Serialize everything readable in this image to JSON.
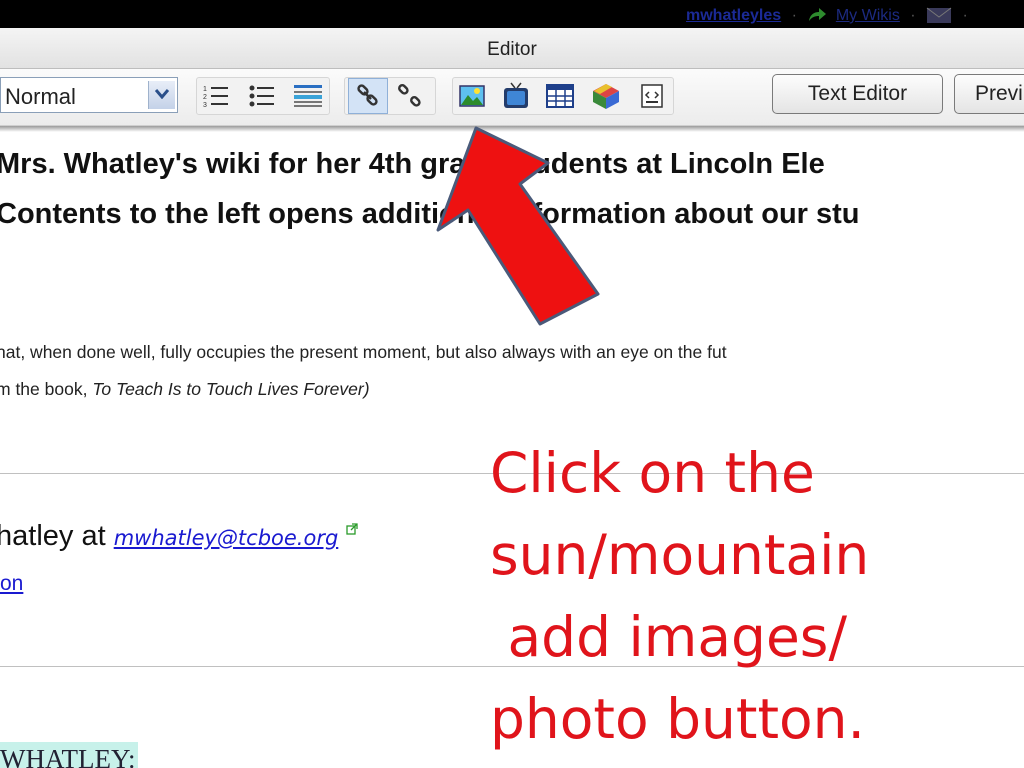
{
  "topbar": {
    "user": "mwhatleyles",
    "my_wikis": "My Wikis",
    "sep": "·"
  },
  "editor": {
    "title": "Editor"
  },
  "toolbar": {
    "format_value": "Normal",
    "text_editor": "Text Editor",
    "preview": "Previ"
  },
  "content": {
    "line1": "Mrs. Whatley's wiki for her 4th grade students at Lincoln Ele",
    "line2": "Contents to the left opens additional information about our stu",
    "quote1": "hat, when done well, fully occupies the present moment, but also always with an eye on the fut",
    "quote2_prefix": "m the book, ",
    "quote2_title": "To Teach Is to Touch Lives Forever)",
    "contact_prefix": "hatley at ",
    "email": "mwhatley@tcboe.org",
    "on_link": "on",
    "whatley": "WHATLEY:"
  },
  "callout": {
    "lines": [
      "Click on the",
      "sun/mountain",
      " add images/",
      "photo button."
    ]
  },
  "colors": {
    "callout": "#e0141b",
    "arrow": "#ee1111",
    "highlight": "#c7f1ea"
  },
  "icons": [
    "numbered-list-icon",
    "bullet-list-icon",
    "horizontal-rule-icon",
    "link-icon",
    "unlink-icon",
    "image-icon",
    "video-icon",
    "table-icon",
    "widget-icon",
    "code-icon",
    "arrow-icon",
    "mail-icon"
  ]
}
